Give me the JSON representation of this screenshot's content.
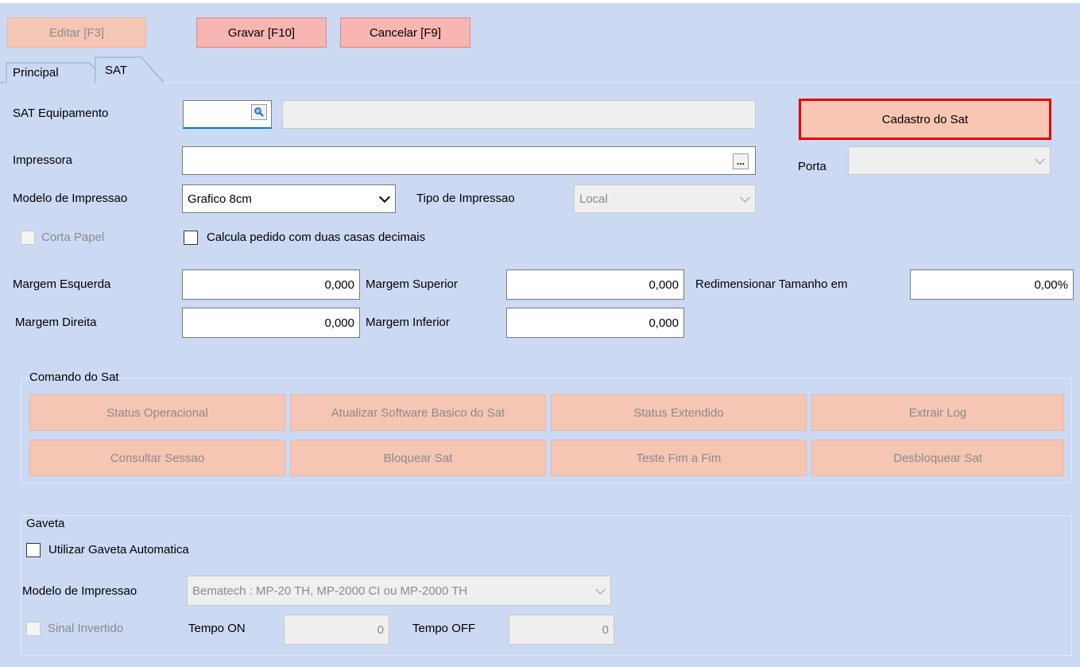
{
  "toolbar": {
    "edit_label": "Editar [F3]",
    "save_label": "Gravar [F10]",
    "cancel_label": "Cancelar [F9]"
  },
  "tabs": [
    {
      "label": "Principal"
    },
    {
      "label": "SAT"
    }
  ],
  "sat": {
    "equipamento_label": "SAT Equipamento",
    "equipamento_value": "",
    "equipamento_desc": "",
    "cadastro_button": "Cadastro do Sat",
    "impressora_label": "Impressora",
    "impressora_value": "",
    "ellipsis": "...",
    "porta_label": "Porta",
    "porta_value": "",
    "modelo_label": "Modelo de Impressao",
    "modelo_value": "Grafico 8cm",
    "tipo_label": "Tipo de Impressao",
    "tipo_value": "Local",
    "corta_papel_label": "Corta Papel",
    "calcula_label": "Calcula pedido com duas casas decimais",
    "margem_esquerda_label": "Margem Esquerda",
    "margem_esquerda_value": "0,000",
    "margem_superior_label": "Margem Superior",
    "margem_superior_value": "0,000",
    "redimensionar_label": "Redimensionar Tamanho em",
    "redimensionar_value": "0,00%",
    "margem_direita_label": "Margem Direita",
    "margem_direita_value": "0,000",
    "margem_inferior_label": "Margem Inferior",
    "margem_inferior_value": "0,000"
  },
  "comando": {
    "title": "Comando do Sat",
    "buttons": [
      "Status Operacional",
      "Atualizar Software Basico do Sat",
      "Status Extendido",
      "Extrair Log",
      "Consultar Sessao",
      "Bloquear Sat",
      "Teste Fim a Fim",
      "Desbloquear Sat"
    ]
  },
  "gaveta": {
    "title": "Gaveta",
    "utilizar_label": "Utilizar Gaveta Automatica",
    "modelo_label": "Modelo de Impressao",
    "modelo_value": "Bematech : MP-20 TH, MP-2000 CI ou MP-2000 TH",
    "sinal_label": "Sinal Invertido",
    "tempo_on_label": "Tempo ON",
    "tempo_on_value": "0",
    "tempo_off_label": "Tempo OFF",
    "tempo_off_value": "0"
  }
}
